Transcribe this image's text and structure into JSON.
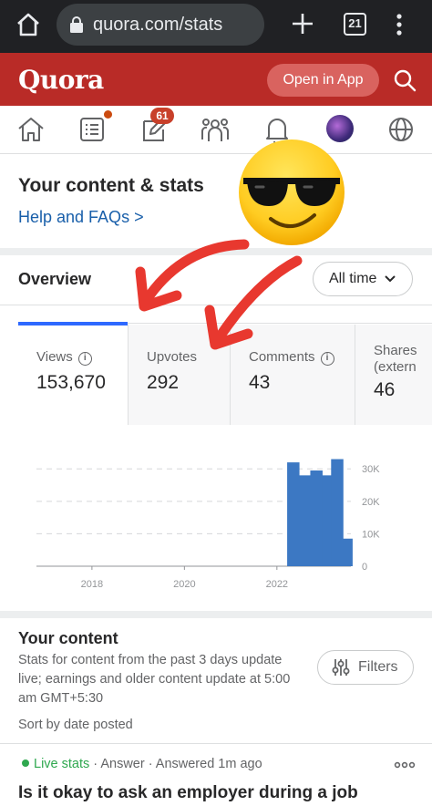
{
  "browser": {
    "url": "quora.com/stats",
    "tab_count": "21"
  },
  "header": {
    "logo": "Quora",
    "open_in_app": "Open in App",
    "brand_color": "#b92b27"
  },
  "nav": {
    "notifications_badge": "61",
    "items": [
      "home-icon",
      "answer-icon",
      "write-icon",
      "spaces-icon",
      "notifications-icon",
      "avatar",
      "language-icon"
    ]
  },
  "page": {
    "title": "Your content & stats",
    "help_link": "Help and FAQs >"
  },
  "overview": {
    "heading": "Overview",
    "range_select": "All time",
    "stats": [
      {
        "label": "Views",
        "value": "153,670"
      },
      {
        "label": "Upvotes",
        "value": "292"
      },
      {
        "label": "Comments",
        "value": "43"
      },
      {
        "label": "Shares",
        "label2": "(extern",
        "value": "46"
      }
    ]
  },
  "chart_data": {
    "type": "bar",
    "title": "",
    "xlabel": "",
    "ylabel": "",
    "x_ticks": [
      "2018",
      "2020",
      "2022"
    ],
    "y_ticks": [
      "0",
      "10K",
      "20K",
      "30K"
    ],
    "ylim": [
      0,
      34000
    ],
    "xlim": [
      2016.8,
      2023.6
    ],
    "grid": true,
    "series": [
      {
        "color": "#3c78c3",
        "points": [
          {
            "x": 2022.35,
            "y": 32000
          },
          {
            "x": 2022.6,
            "y": 28000
          },
          {
            "x": 2022.85,
            "y": 29500
          },
          {
            "x": 2023.1,
            "y": 28000
          },
          {
            "x": 2023.3,
            "y": 33000
          },
          {
            "x": 2023.5,
            "y": 8500
          }
        ]
      }
    ]
  },
  "your_content": {
    "heading": "Your content",
    "description": "Stats for content from the past 3 days update live; earnings and older content update at 5:00 am GMT+5:30",
    "filters": "Filters",
    "sort": "Sort by date posted"
  },
  "item": {
    "live": "Live stats",
    "meta": "· Answer · Answered 1m ago",
    "question": "Is it okay to ask an employer during a job"
  }
}
